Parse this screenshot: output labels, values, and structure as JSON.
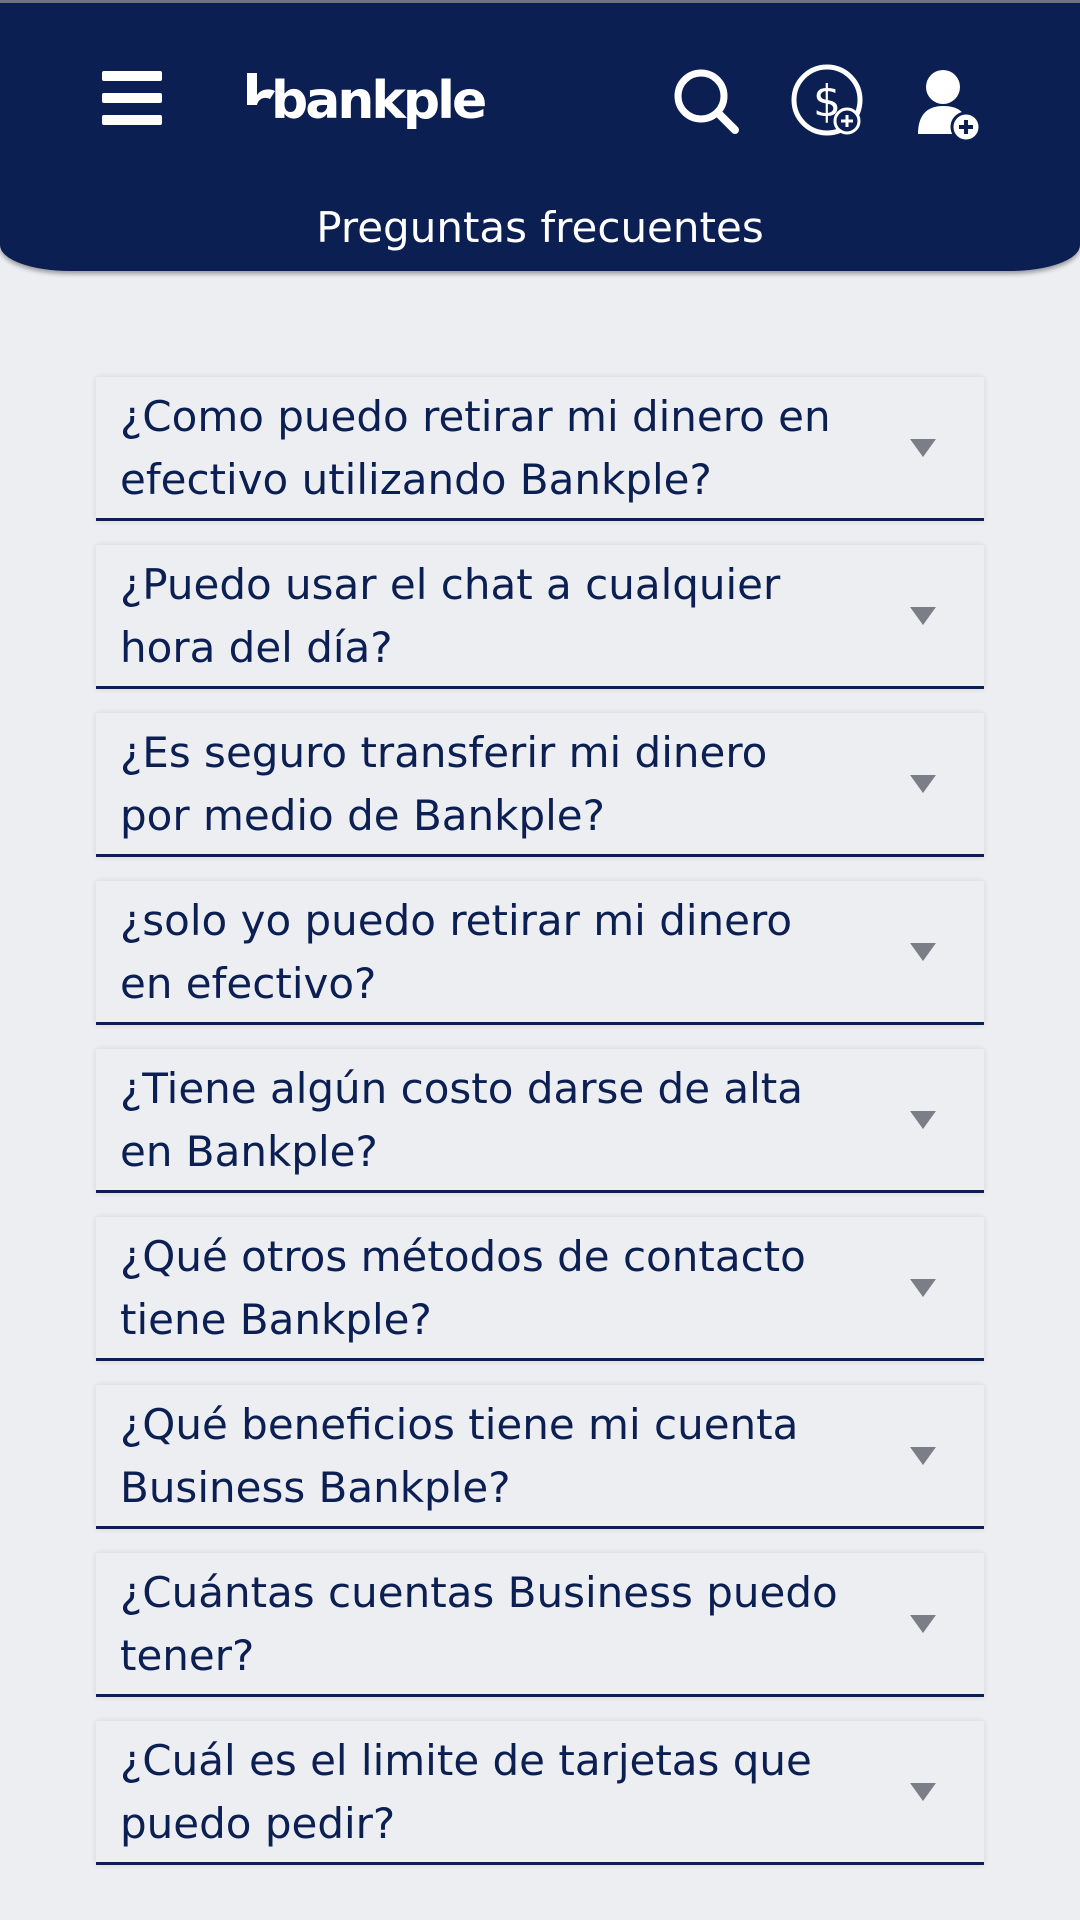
{
  "header": {
    "logo_text": "bankple",
    "title": "Preguntas frecuentes",
    "icons": [
      "menu-icon",
      "search-icon",
      "dollar-add-icon",
      "user-add-icon"
    ]
  },
  "colors": {
    "primary": "#0c1f52",
    "background": "#edeef1",
    "arrow": "#7b7e86"
  },
  "faq": [
    {
      "question": "¿Como puedo retirar mi dinero en efectivo utilizando Bankple?"
    },
    {
      "question": "¿Puedo usar el chat a cualquier hora del día?"
    },
    {
      "question": "¿Es seguro transferir mi dinero por medio de Bankple?"
    },
    {
      "question": "¿solo yo puedo retirar mi dinero en efectivo?"
    },
    {
      "question": "¿Tiene algún costo darse de alta en Bankple?"
    },
    {
      "question": "¿Qué otros métodos de contacto tiene Bankple?"
    },
    {
      "question": "¿Qué beneficios tiene mi cuenta Business Bankple?"
    },
    {
      "question": "¿Cuántas cuentas Business puedo tener?"
    },
    {
      "question": "¿Cuál es el limite de tarjetas que puedo pedir?"
    }
  ]
}
